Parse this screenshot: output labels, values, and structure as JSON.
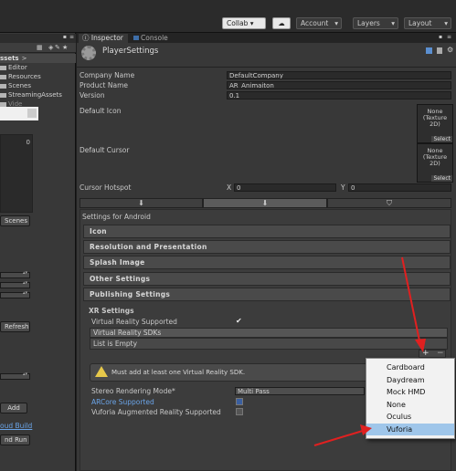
{
  "toolbar": {
    "collab": "Collab ▾",
    "account": "Account",
    "layers": "Layers",
    "layout": "Layout"
  },
  "left": {
    "header": "ssets",
    "items": [
      "Editor",
      "Resources",
      "Scenes",
      "StreamingAssets",
      "Vide"
    ],
    "count": "0",
    "scenes_btn": "Scenes",
    "refresh_btn": "Refresh",
    "add_btn": "Add",
    "build_link": "oud Build",
    "run_btn": "nd Run"
  },
  "tabs": {
    "inspector": "Inspector",
    "console": "Console"
  },
  "title": "PlayerSettings",
  "fields": {
    "company_label": "Company Name",
    "company_value": "DefaultCompany",
    "product_label": "Product Name",
    "product_value": "AR_Animaiton",
    "version_label": "Version",
    "version_value": "0.1",
    "icon_label": "Default Icon",
    "cursor_label": "Default Cursor",
    "none_texture": "None (Texture 2D)",
    "select": "Select",
    "hotspot_label": "Cursor Hotspot",
    "x": "X",
    "x_val": "0",
    "y": "Y",
    "y_val": "0"
  },
  "settings_for": "Settings for Android",
  "sections": [
    "Icon",
    "Resolution and Presentation",
    "Splash Image",
    "Other Settings",
    "Publishing Settings"
  ],
  "xr": {
    "title": "XR Settings",
    "vr_supported": "Virtual Reality Supported",
    "vr_sdks": "Virtual Reality SDKs",
    "list_empty": "List is Empty",
    "warning": "Must add at least one Virtual Reality SDK.",
    "stereo_label": "Stereo Rendering Mode*",
    "stereo_value": "Multi Pass",
    "arcore": "ARCore Supported",
    "vuforia": "Vuforia Augmented Reality Supported"
  },
  "dropdown": {
    "items": [
      "Cardboard",
      "Daydream",
      "Mock HMD",
      "None",
      "Oculus",
      "Vuforia"
    ],
    "selected": "Vuforia"
  },
  "colors": {
    "arrow": "#e02020",
    "highlight": "#9fc6ea",
    "link": "#6aa4e8"
  }
}
